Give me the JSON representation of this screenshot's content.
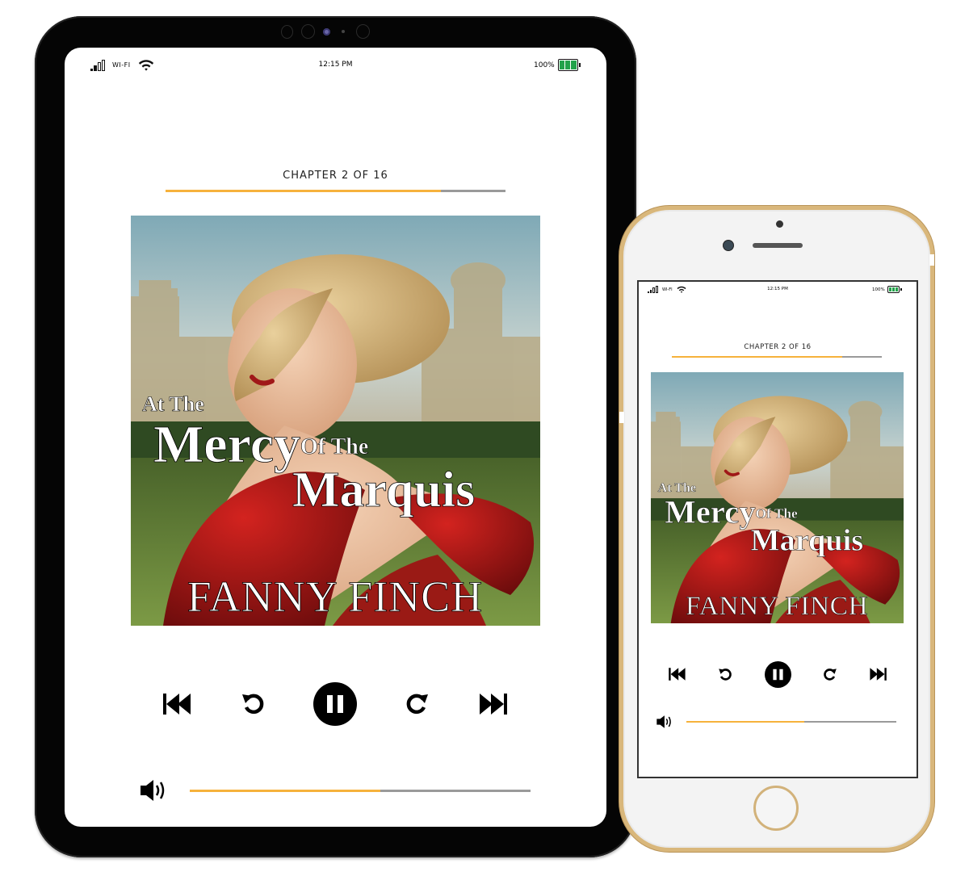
{
  "status_bar": {
    "network_label": "WI-FI",
    "time": "12:15 PM",
    "battery_percent_label": "100%",
    "signal_icon": "signal-bars-icon",
    "wifi_icon": "wifi-icon",
    "battery_icon": "battery-full-icon"
  },
  "player": {
    "chapter_label": "CHAPTER 2 OF 16",
    "chapter_progress": 0.81,
    "volume_level": 0.56,
    "cover": {
      "title_line_1": "At The",
      "title_line_2": "Mercy",
      "title_line_3": "Of The",
      "title_line_4": "Marquis",
      "author": "FANNY FINCH"
    },
    "controls": [
      {
        "name": "skip-previous",
        "icon": "skip-back-icon"
      },
      {
        "name": "rewind",
        "icon": "rotate-ccw-icon"
      },
      {
        "name": "pause",
        "icon": "pause-icon"
      },
      {
        "name": "forward",
        "icon": "rotate-cw-icon"
      },
      {
        "name": "skip-next",
        "icon": "skip-forward-icon"
      }
    ],
    "volume_icon": "speaker-volume-icon"
  },
  "colors": {
    "accent": "#f6b23c",
    "track": "#9a9a9a",
    "battery": "#22a24a",
    "tablet_frame": "#050505",
    "phone_frame": "#d9b77b"
  }
}
